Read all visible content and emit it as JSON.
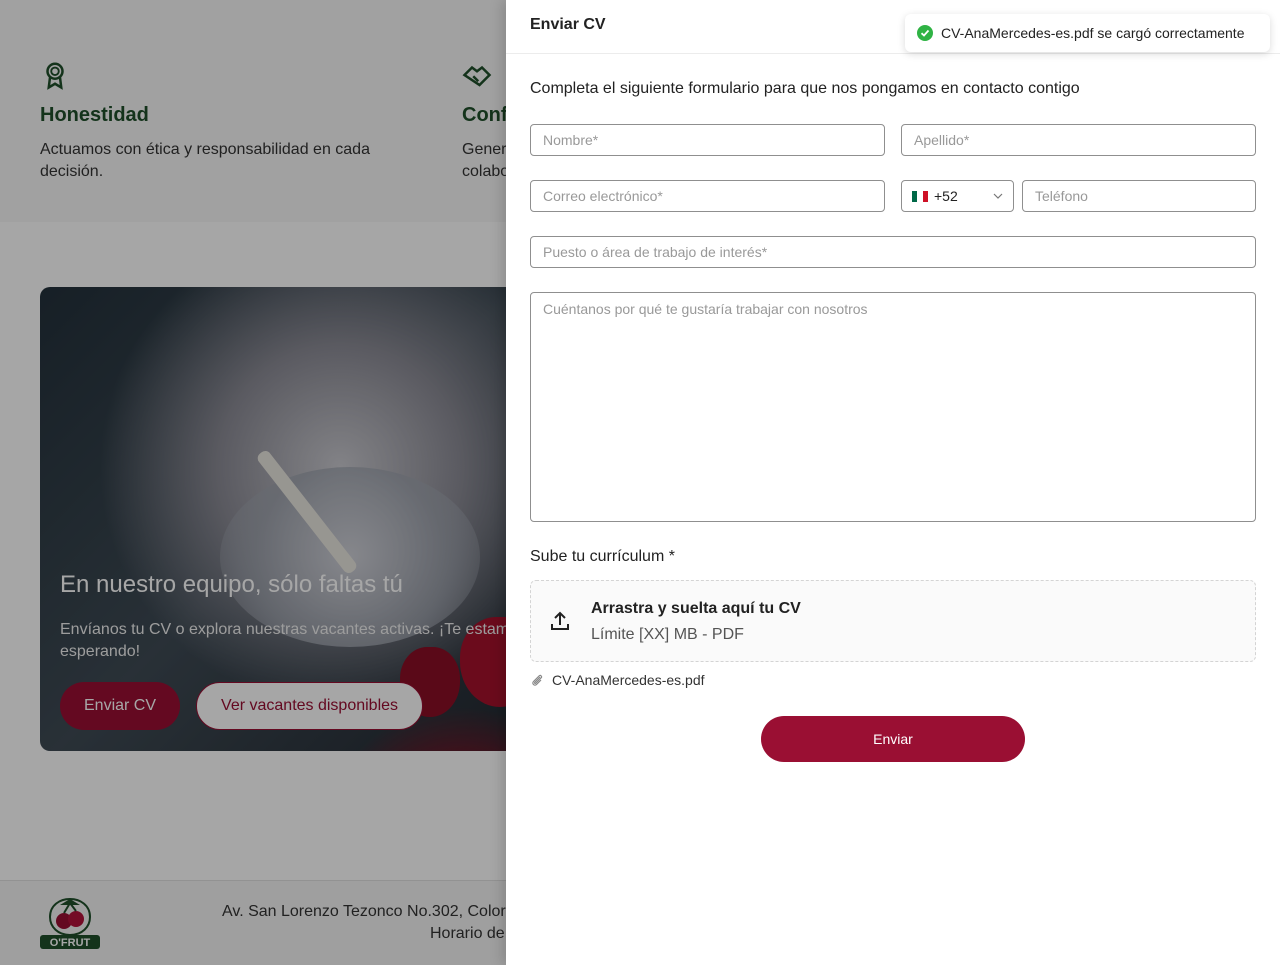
{
  "background": {
    "values": [
      {
        "title": "Honestidad",
        "description": "Actuamos con ética y responsabilidad en cada decisión.",
        "icon": "award-icon"
      },
      {
        "title": "Conf",
        "description": "Gener colabo",
        "icon": "handshake-icon"
      }
    ],
    "hero": {
      "title": "En nuestro equipo, sólo faltas tú",
      "description": "Envíanos tu CV o explora nuestras vacantes activas. ¡Te estam esperando!",
      "primary_button": "Enviar CV",
      "secondary_button": "Ver vacantes disponibles"
    },
    "footer": {
      "logo_text": "O'FRUT",
      "address_line1": "Av. San Lorenzo Tezonco No.302, Color",
      "address_line2": "Horario de"
    }
  },
  "drawer": {
    "title": "Enviar CV",
    "intro": "Completa el siguiente formulario para que nos pongamos en contacto contigo",
    "fields": {
      "first_name_placeholder": "Nombre*",
      "last_name_placeholder": "Apellido*",
      "email_placeholder": "Correo electrónico*",
      "country_code": "+52",
      "phone_placeholder": "Teléfono",
      "position_placeholder": "Puesto o área de trabajo de interés*",
      "message_placeholder": "Cuéntanos por qué te gustaría trabajar con nosotros"
    },
    "upload": {
      "label": "Sube tu currículum *",
      "title": "Arrastra y suelta aquí tu CV",
      "subtitle": "Límite [XX] MB - PDF",
      "file_name": "CV-AnaMercedes-es.pdf"
    },
    "submit_label": "Enviar"
  },
  "toast": {
    "message": "CV-AnaMercedes-es.pdf se cargó correctamente",
    "color": "#2fb344"
  },
  "colors": {
    "accent": "#9a0f33",
    "green": "#1f4f2a"
  }
}
